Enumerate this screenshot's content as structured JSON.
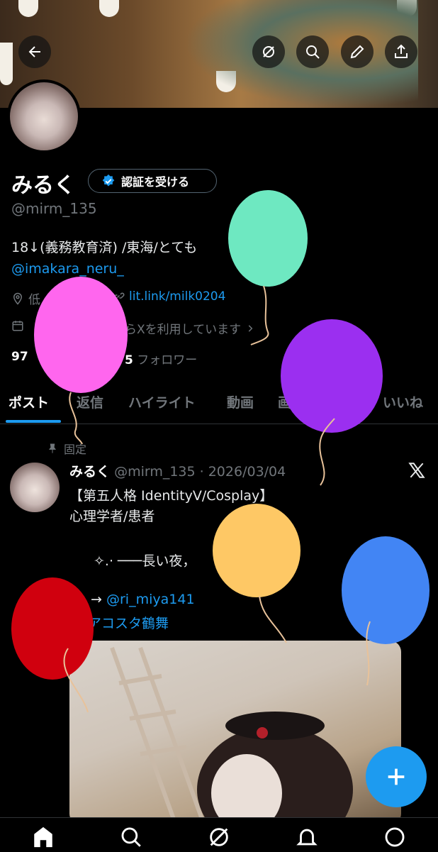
{
  "header": {
    "back_icon": "arrow-left-icon",
    "grok_icon": "grok-icon",
    "search_icon": "search-icon",
    "edit_icon": "pencil-icon",
    "share_icon": "share-icon"
  },
  "profile": {
    "display_name": "みるく",
    "verify_button_label": "認証を受ける",
    "handle": "@mirm_135",
    "bio": "18↓(義務教育済) /東海/とても",
    "bio_link": "@imakara_neru_",
    "location": "低",
    "website": "lit.link/milk0204",
    "joined": "らXを利用しています",
    "following_count": "97",
    "follower_count": "5",
    "follower_label": "フォロワー"
  },
  "tabs": [
    {
      "label": "ポスト"
    },
    {
      "label": "返信"
    },
    {
      "label": "ハイライト"
    },
    {
      "label": "動画"
    },
    {
      "label": "画"
    },
    {
      "label": "いいね"
    }
  ],
  "post": {
    "pinned_label": "固定",
    "author_name": "みるく",
    "author_handle_date": "@mirm_135 · 2026/03/04",
    "line1": "【第五人格 IdentityV/Cosplay】",
    "line2": "心理学者/患者",
    "line3": "✧.· ───長い夜，",
    "line4_prefix": "→",
    "line4_link": "@ri_miya141",
    "line5": "アコスタ鶴舞"
  },
  "colors": {
    "accent": "#1d9bf0",
    "muted": "#71767b",
    "background": "#000000"
  },
  "balloons": [
    "#6ee8c1",
    "#ff66ee",
    "#9b2ff0",
    "#fec865",
    "#4285f4",
    "#d0000e"
  ]
}
